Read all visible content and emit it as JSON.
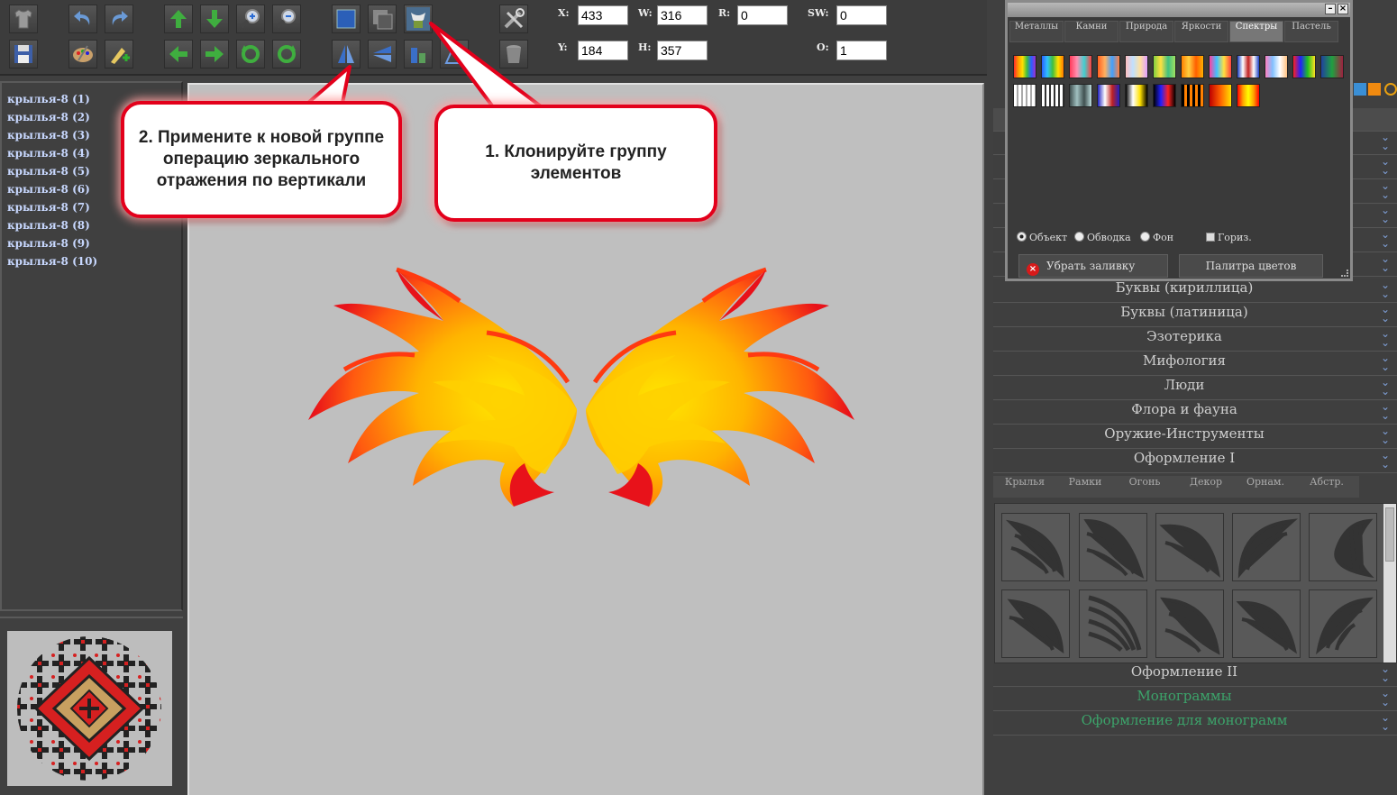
{
  "toolbar": {
    "fields": {
      "x": {
        "label": "X:",
        "value": "433"
      },
      "y": {
        "label": "Y:",
        "value": "184"
      },
      "w": {
        "label": "W:",
        "value": "316"
      },
      "h": {
        "label": "H:",
        "value": "357"
      },
      "r": {
        "label": "R:",
        "value": "0"
      },
      "sw": {
        "label": "SW:",
        "value": "0"
      },
      "o": {
        "label": "O:",
        "value": "1"
      }
    },
    "icons": [
      "tshirt-icon",
      "undo-icon",
      "redo-icon",
      "move-up-icon",
      "move-down-icon",
      "zoom-in-icon",
      "zoom-out-icon",
      "bring-front-icon",
      "send-back-icon",
      "clone-group-icon",
      "tools-icon",
      "save-icon",
      "paint-palette-icon",
      "add-text-icon",
      "move-left-icon",
      "move-right-icon",
      "rotate-left-icon",
      "rotate-right-icon",
      "flip-vertical-icon",
      "flip-horizontal-icon",
      "align-bottom-icon",
      "align-right-icon",
      "trash-icon"
    ]
  },
  "layers": {
    "items": [
      "крылья-8 (1)",
      "крылья-8 (2)",
      "крылья-8 (3)",
      "крылья-8 (4)",
      "крылья-8 (5)",
      "крылья-8 (6)",
      "крылья-8 (7)",
      "крылья-8 (8)",
      "крылья-8 (9)",
      "крылья-8 (10)"
    ]
  },
  "callouts": {
    "step2": "2. Примените к новой группе операцию зеркального отражения по вертикали",
    "step1": "1. Клонируйте группу элементов"
  },
  "palette": {
    "tabs": [
      "Металлы",
      "Камни",
      "Природа",
      "Яркости",
      "Спектры",
      "Пастель"
    ],
    "active_tab": "Спектры",
    "radio": {
      "object": "Объект",
      "stroke": "Обводка",
      "background": "Фон"
    },
    "checkbox": "Гориз.",
    "remove_fill": "Убрать заливку",
    "color_palette": "Палитра цветов"
  },
  "categories": {
    "items": [
      "Буквы (кириллица)",
      "Буквы (латиница)",
      "Эзотерика",
      "Мифология",
      "Люди",
      "Флора и фауна",
      "Оружие-Инструменты",
      "Оформление I"
    ],
    "after": [
      "Оформление II",
      "Монограммы",
      "Оформление для монограмм"
    ]
  },
  "subtabs": [
    "Крылья",
    "Рамки",
    "Огонь",
    "Декор",
    "Орнам.",
    "Абстр."
  ],
  "colors": {
    "accent_red": "#e3001b",
    "canvas": "#bfbfbf",
    "link_green": "#3ca36a"
  }
}
